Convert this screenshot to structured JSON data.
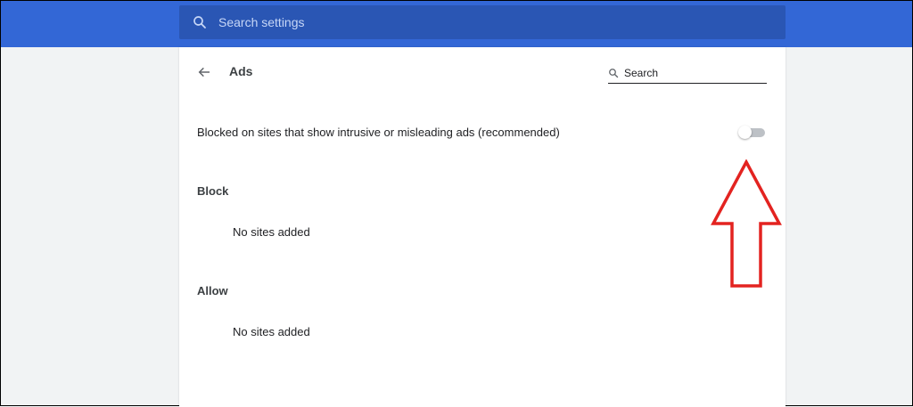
{
  "topbar": {
    "search_placeholder": "Search settings",
    "search_icon": "search-icon",
    "color": "#3367d6"
  },
  "header": {
    "back_icon": "arrow-back-icon",
    "title": "Ads",
    "search_placeholder": "Search",
    "search_icon": "search-icon"
  },
  "setting": {
    "label": "Blocked on sites that show intrusive or misleading ads (recommended)",
    "toggle_on": false
  },
  "sections": {
    "block": {
      "title": "Block",
      "empty_text": "No sites added"
    },
    "allow": {
      "title": "Allow",
      "empty_text": "No sites added"
    }
  },
  "annotation": {
    "type": "up-arrow",
    "color": "#e32320"
  }
}
